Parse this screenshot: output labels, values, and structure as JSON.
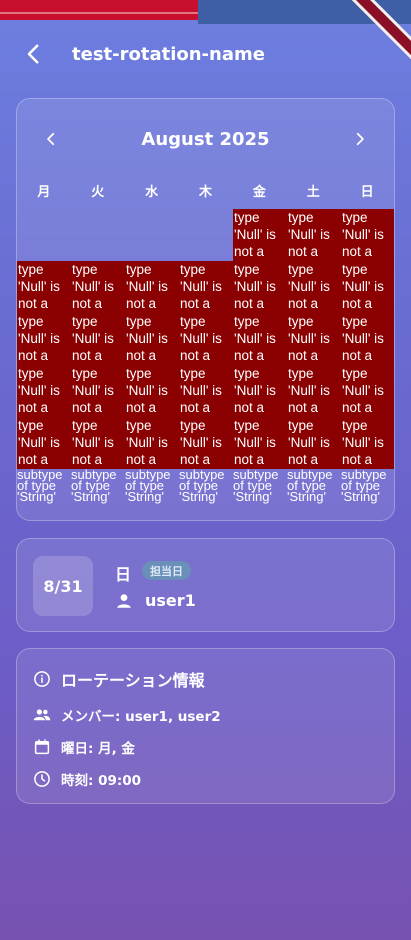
{
  "appbar": {
    "title": "test-rotation-name"
  },
  "calendar": {
    "month_label": "August 2025",
    "weekdays": [
      "月",
      "火",
      "水",
      "木",
      "金",
      "土",
      "日"
    ],
    "error_lines": [
      "type",
      "'Null' is",
      "not a"
    ],
    "overflow_lines": [
      "subtype",
      "of type",
      "'String'"
    ]
  },
  "selected": {
    "date": "8/31",
    "day": "日",
    "badge": "担当日",
    "user": "user1"
  },
  "info": {
    "title": "ローテーション情報",
    "members": "メンバー: user1, user2",
    "weekdays": "曜日: 月, 金",
    "time": "時刻: 09:00"
  },
  "colors": {
    "error_bg": "#8b0000",
    "badge_bg": "#6a8fb8",
    "debug_red": "#c8102e"
  }
}
